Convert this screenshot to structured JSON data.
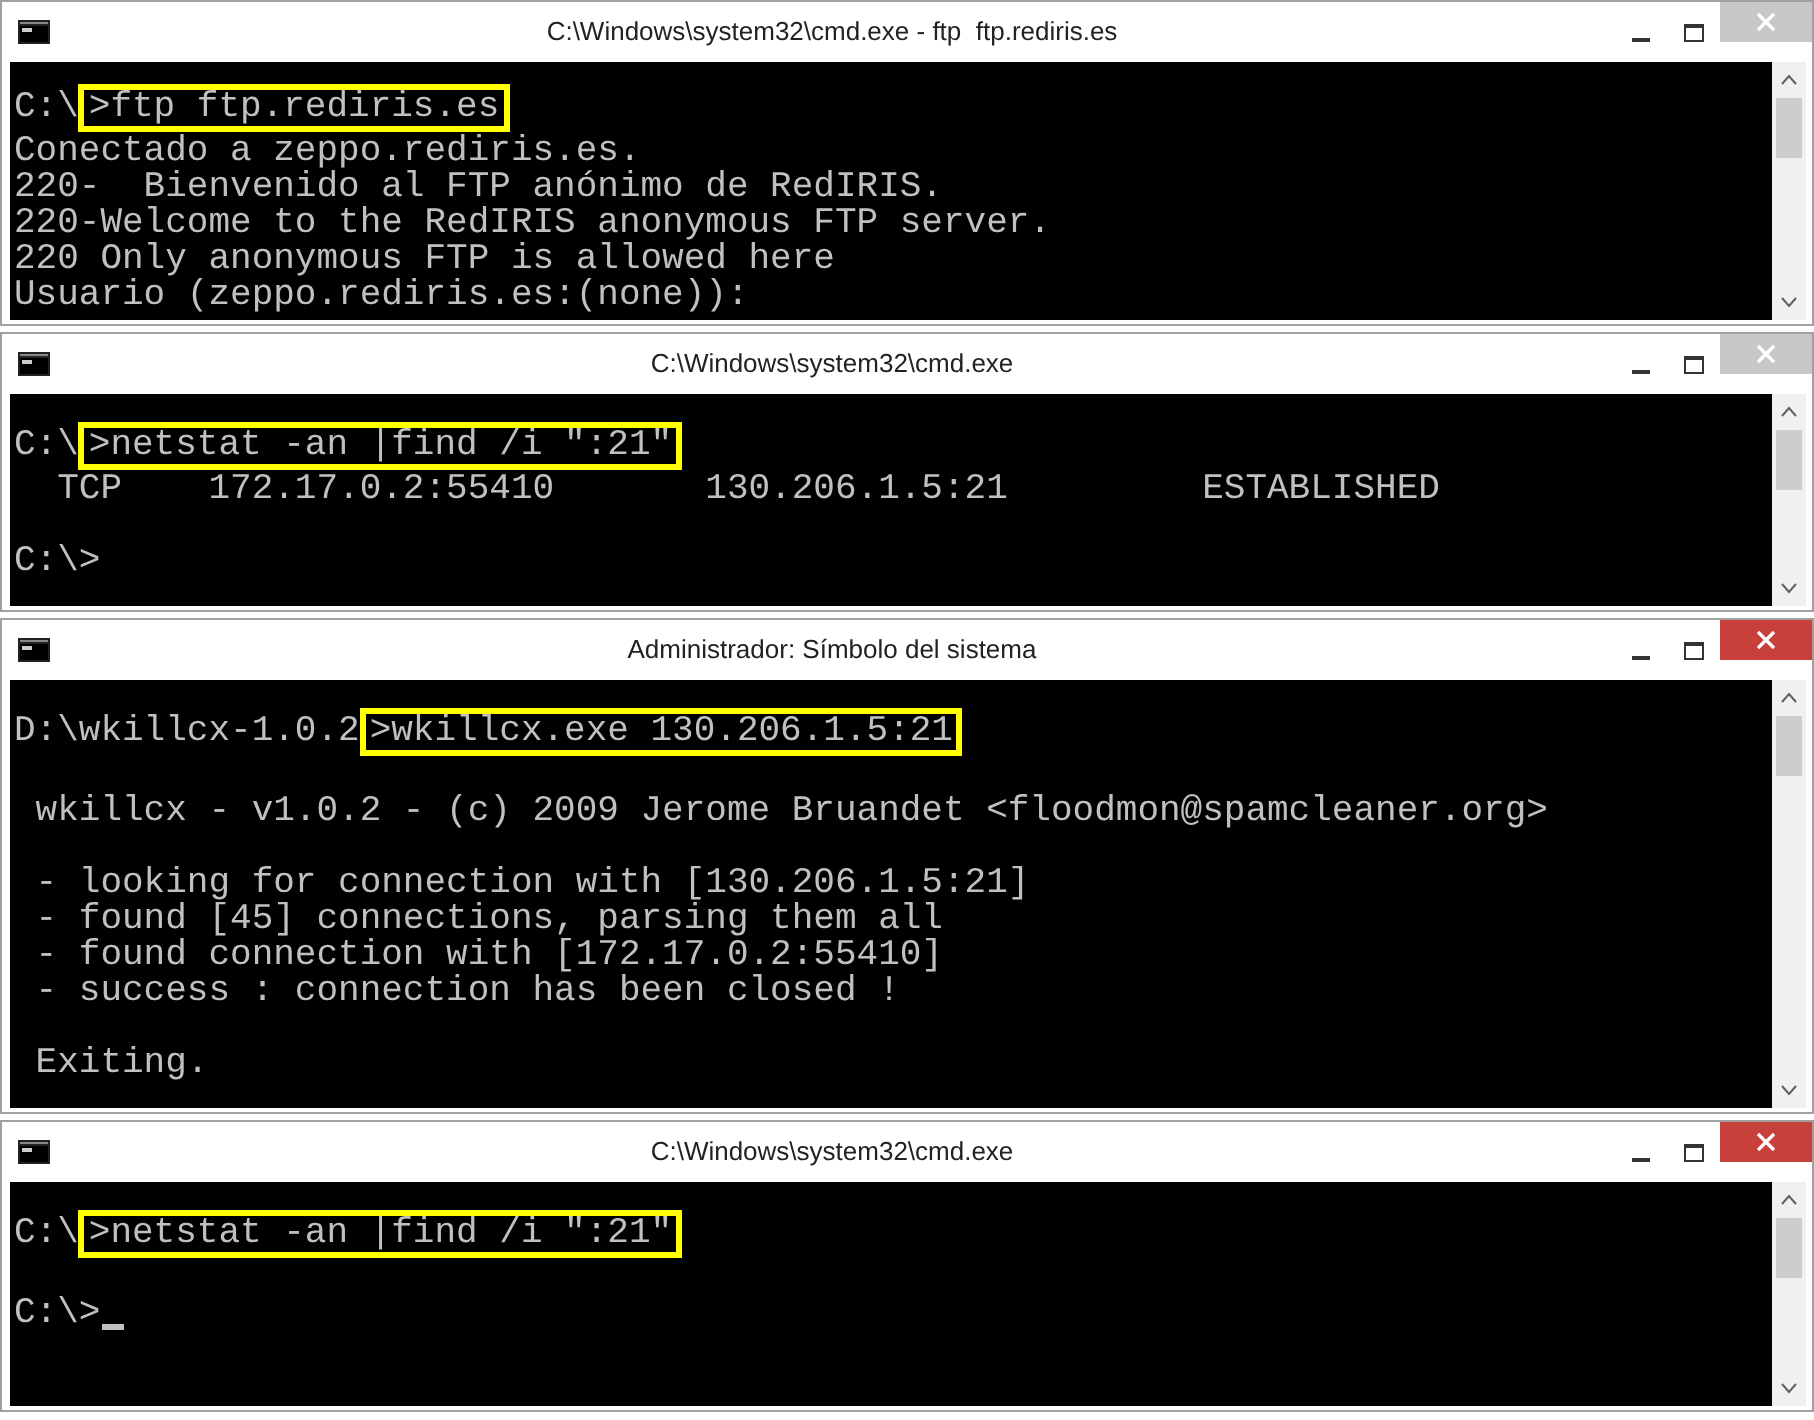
{
  "windows": [
    {
      "title": "C:\\Windows\\system32\\cmd.exe - ftp  ftp.rediris.es",
      "active": false,
      "lines": [
        {
          "kind": "command",
          "prompt": "C:\\",
          "command": ">ftp ftp.rediris.es"
        },
        {
          "kind": "output",
          "text": "Conectado a zeppo.rediris.es."
        },
        {
          "kind": "output",
          "text": "220-  Bienvenido al FTP anónimo de RedIRIS."
        },
        {
          "kind": "output",
          "text": "220-Welcome to the RedIRIS anonymous FTP server."
        },
        {
          "kind": "output",
          "text": "220 Only anonymous FTP is allowed here"
        },
        {
          "kind": "output",
          "text": "Usuario (zeppo.rediris.es:(none)):"
        }
      ]
    },
    {
      "title": "C:\\Windows\\system32\\cmd.exe",
      "active": false,
      "lines": [
        {
          "kind": "command",
          "prompt": "C:\\",
          "command": ">netstat -an |find /i \":21\""
        },
        {
          "kind": "output",
          "text": "  TCP    172.17.0.2:55410       130.206.1.5:21         ESTABLISHED"
        },
        {
          "kind": "blank"
        },
        {
          "kind": "output",
          "text": "C:\\>"
        }
      ]
    },
    {
      "title": "Administrador: Símbolo del sistema",
      "active": true,
      "lines": [
        {
          "kind": "command",
          "prompt": "D:\\wkillcx-1.0.2",
          "command": ">wkillcx.exe 130.206.1.5:21"
        },
        {
          "kind": "blank"
        },
        {
          "kind": "output",
          "text": " wkillcx - v1.0.2 - (c) 2009 Jerome Bruandet <floodmon@spamcleaner.org>"
        },
        {
          "kind": "blank"
        },
        {
          "kind": "output",
          "text": " - looking for connection with [130.206.1.5:21]"
        },
        {
          "kind": "output",
          "text": " - found [45] connections, parsing them all"
        },
        {
          "kind": "output",
          "text": " - found connection with [172.17.0.2:55410]"
        },
        {
          "kind": "output",
          "text": " - success : connection has been closed !"
        },
        {
          "kind": "blank"
        },
        {
          "kind": "output",
          "text": " Exiting."
        }
      ]
    },
    {
      "title": "C:\\Windows\\system32\\cmd.exe",
      "active": true,
      "lines": [
        {
          "kind": "command",
          "prompt": "C:\\",
          "command": ">netstat -an |find /i \":21\""
        },
        {
          "kind": "blank"
        },
        {
          "kind": "output",
          "text": "C:\\>",
          "cursor": true
        }
      ]
    }
  ]
}
